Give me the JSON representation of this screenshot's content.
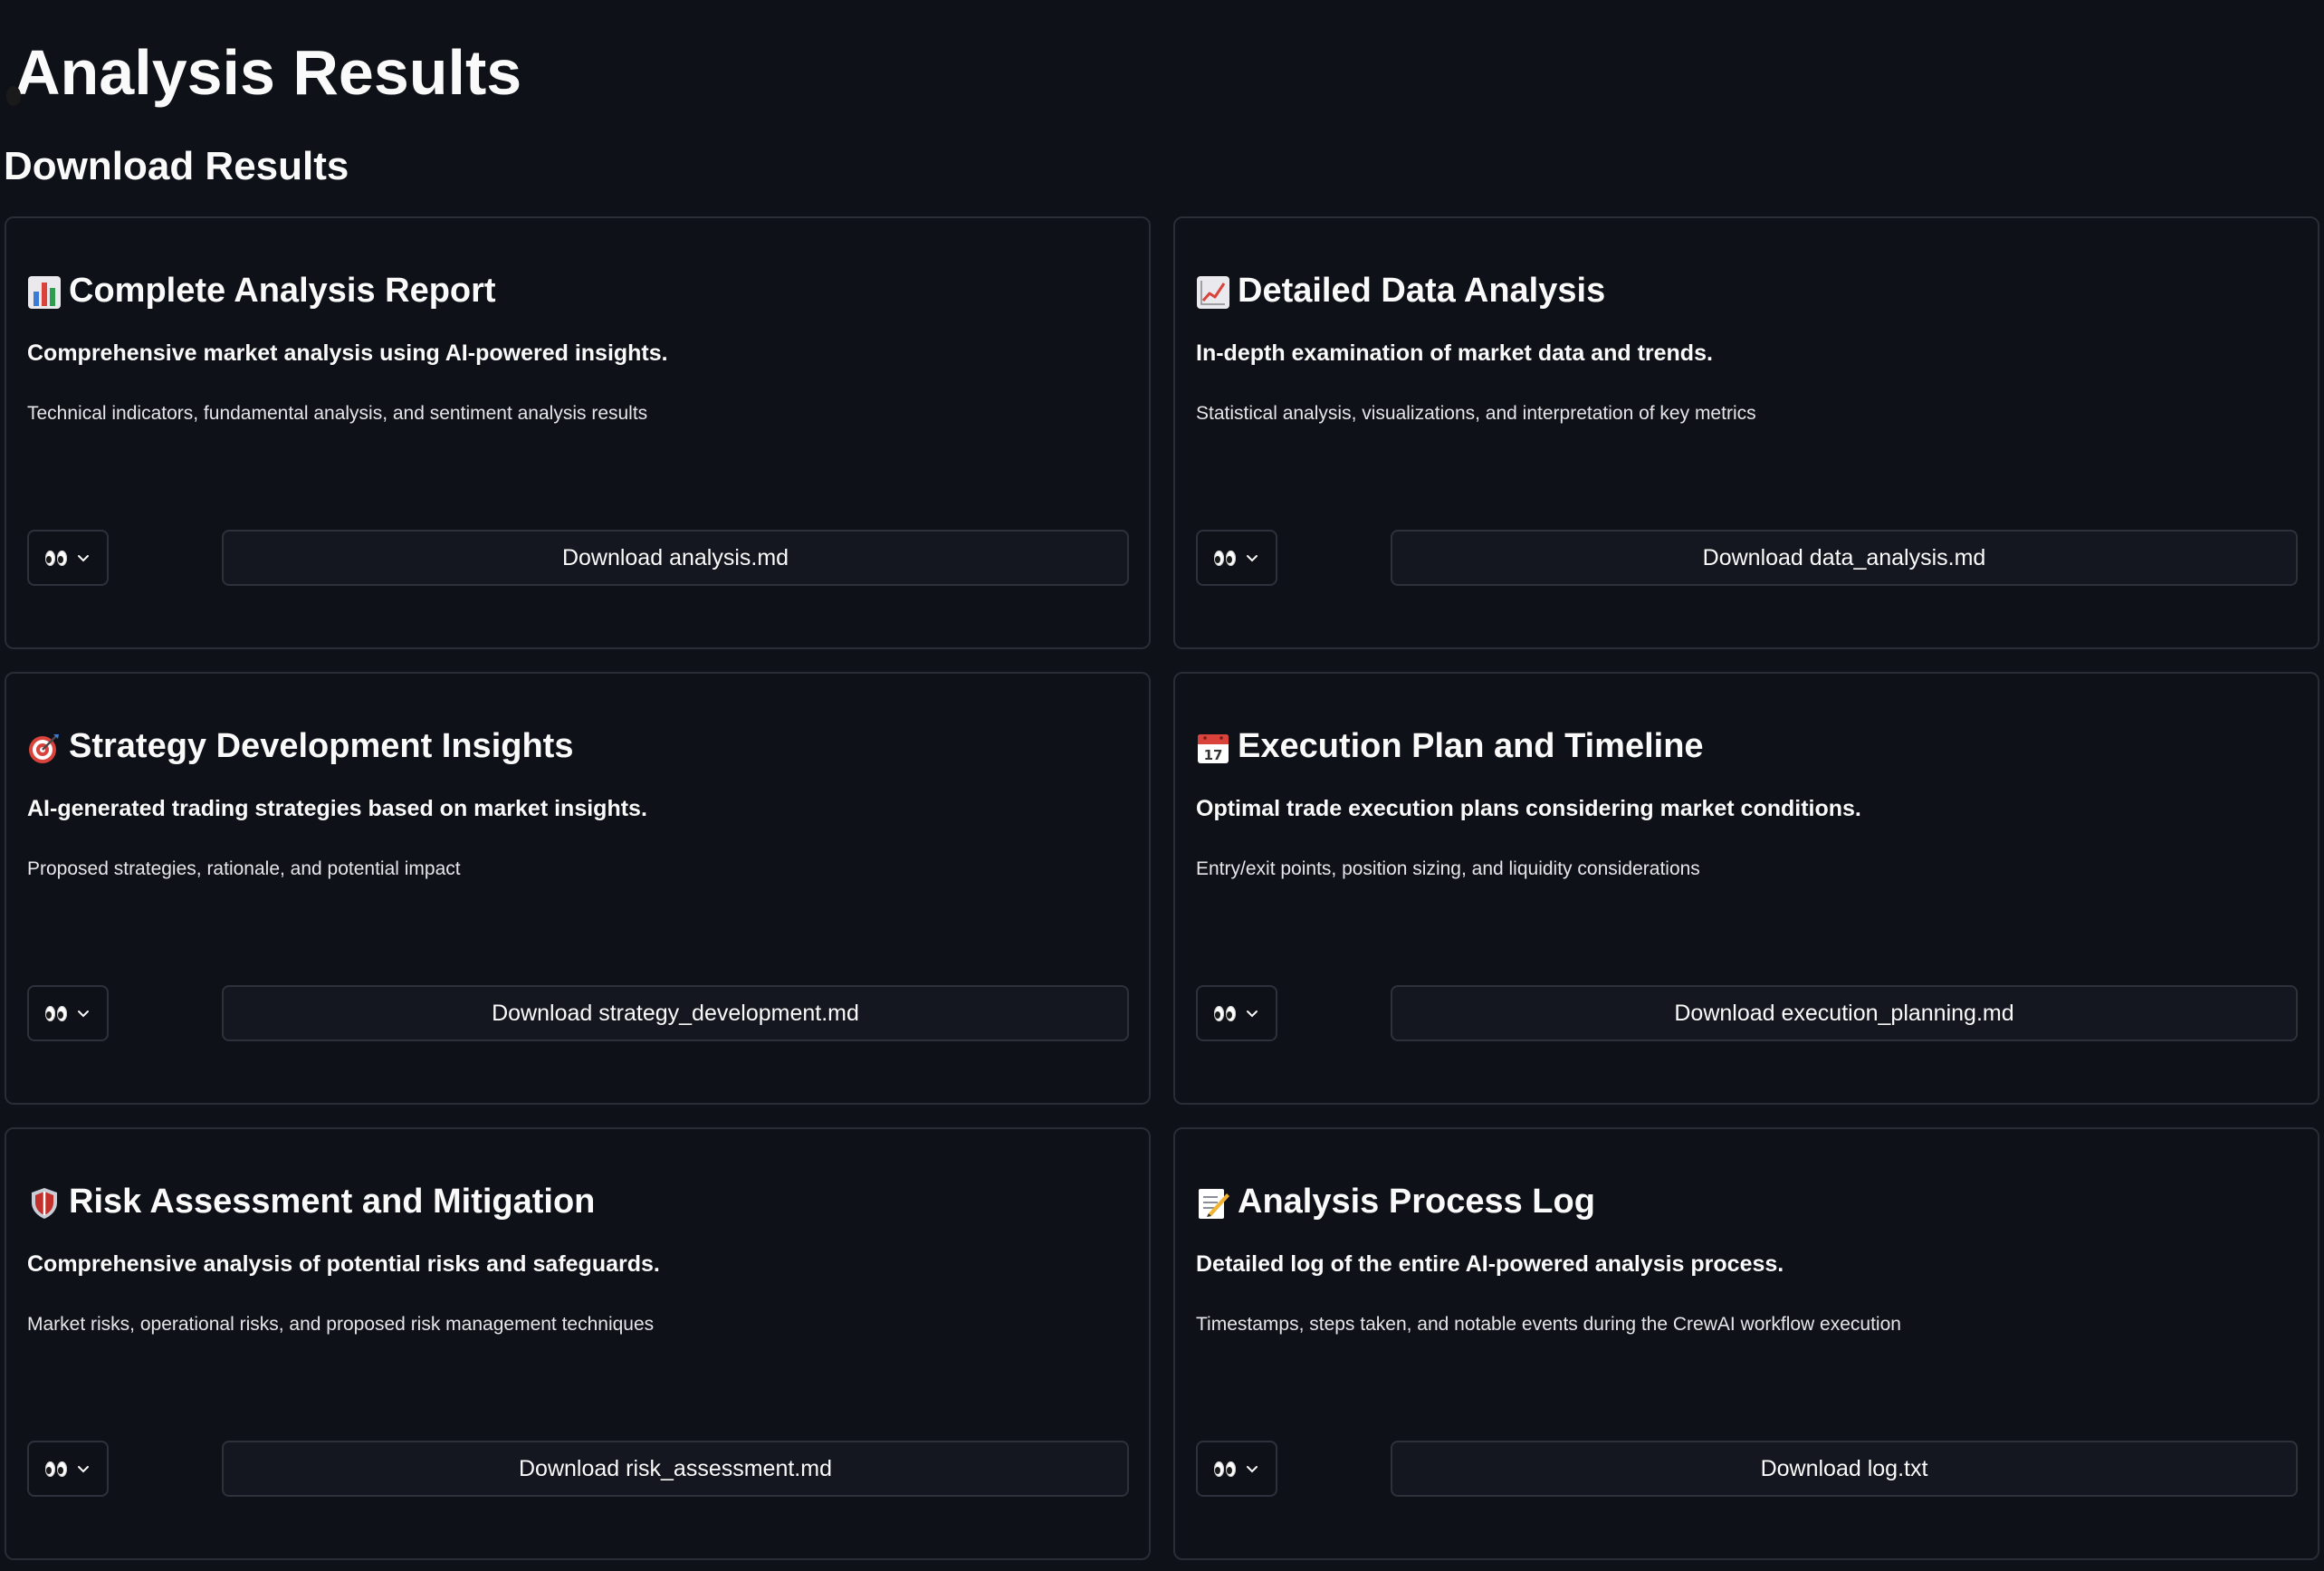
{
  "page": {
    "title": "Analysis Results",
    "title_icon": "eyes-icon",
    "subtitle": "Download Results"
  },
  "cards": [
    {
      "icon": "bar-chart-icon",
      "title": "Complete Analysis Report",
      "description": "Comprehensive market analysis using AI-powered insights.",
      "detail": "Technical indicators, fundamental analysis, and sentiment analysis results",
      "download_label": "Download analysis.md"
    },
    {
      "icon": "chart-increasing-icon",
      "title": "Detailed Data Analysis",
      "description": "In-depth examination of market data and trends.",
      "detail": "Statistical analysis, visualizations, and interpretation of key metrics",
      "download_label": "Download data_analysis.md"
    },
    {
      "icon": "direct-hit-icon",
      "title": "Strategy Development Insights",
      "description": "AI-generated trading strategies based on market insights.",
      "detail": "Proposed strategies, rationale, and potential impact",
      "download_label": "Download strategy_development.md"
    },
    {
      "icon": "calendar-icon",
      "title": "Execution Plan and Timeline",
      "description": "Optimal trade execution plans considering market conditions.",
      "detail": "Entry/exit points, position sizing, and liquidity considerations",
      "download_label": "Download execution_planning.md"
    },
    {
      "icon": "shield-icon",
      "title": "Risk Assessment and Mitigation",
      "description": "Comprehensive analysis of potential risks and safeguards.",
      "detail": "Market risks, operational risks, and proposed risk management techniques",
      "download_label": "Download risk_assessment.md"
    },
    {
      "icon": "memo-icon",
      "title": "Analysis Process Log",
      "description": "Detailed log of the entire AI-powered analysis process.",
      "detail": "Timestamps, steps taken, and notable events during the CrewAI workflow execution",
      "download_label": "Download log.txt"
    }
  ],
  "colors": {
    "background": "#0e1117",
    "border": "#2a2d36",
    "button_bg": "#14171f",
    "text": "#fafafa"
  }
}
